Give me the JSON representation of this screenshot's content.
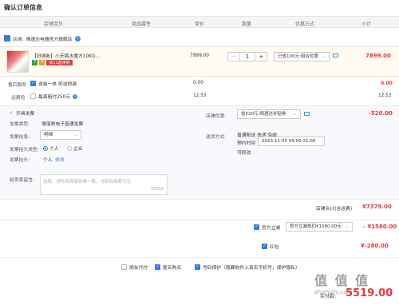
{
  "page_title": "确认订单信息",
  "columns": [
    "店铺宝贝",
    "商品属性",
    "单价",
    "数量",
    "优惠方式",
    "小计"
  ],
  "shop": {
    "label": "店铺:",
    "name": "晴速达电器官方旗舰店"
  },
  "item": {
    "name": "【旧焕新】小天鹅水魔方10KG...",
    "badges": [
      "7",
      "¥",
      "双11超净购"
    ],
    "price": "7999.00",
    "qty_minus": "−",
    "qty": "1",
    "qty_plus": "+",
    "discount_select": "已省100元:组合优惠",
    "subtotal": "7899.00"
  },
  "service": {
    "label": "售后服务",
    "option": "送装一体  即送即装",
    "price": "0.00",
    "subtotal": "0.00"
  },
  "insurance": {
    "label": "运费险",
    "option": "最高赔付250元",
    "price": "12.53",
    "subtotal": "12.53"
  },
  "invoice": {
    "toggle": "开具发票",
    "type_label": "发票类型:",
    "type_value": "增值税电子普通发票",
    "info_label": "发票信息:",
    "info_value": "明细",
    "head_type_label": "发票抬头类型:",
    "head_personal": "个人",
    "head_company": "企业",
    "head_label": "发票抬头:",
    "head_value": "个人",
    "head_edit": "修改"
  },
  "shop_discount": {
    "label": "店铺优惠:",
    "select": "省520元:晴速达补贴券",
    "amount": "-520.00"
  },
  "delivery": {
    "label": "送货方式:",
    "mode": "普通配送 快递 免邮",
    "time_label": "预约时间",
    "time_value": "2023-11-05 09:00-21:00",
    "note": "可修改"
  },
  "message": {
    "label": "给卖家留言:",
    "placeholder": "选填，请先和商家协商一致，付款后商家可见",
    "counter": "0/200"
  },
  "shop_total": {
    "label": "店铺合计(含运费)",
    "value": "¥7379.00"
  },
  "platform_discount": {
    "label": "官方立减",
    "select": "官方立减抵扣¥1580.00元",
    "amount": "- ¥1580.00"
  },
  "red_packet": {
    "label": "红包",
    "amount": "¥-280.00"
  },
  "footer": {
    "friend_pay": "朋友代付",
    "anonymous": "匿名购买",
    "privacy": "号码保护（隐藏收件人真实手机号，保护隐私）",
    "pay_label": "实付款:",
    "pay_value": "5519.00"
  },
  "watermark": {
    "text": "值 值 值",
    "sub": "zhizhizhi.com"
  },
  "colors": {
    "accent": "#e4393c",
    "brand_blue": "#3a7bd5"
  }
}
